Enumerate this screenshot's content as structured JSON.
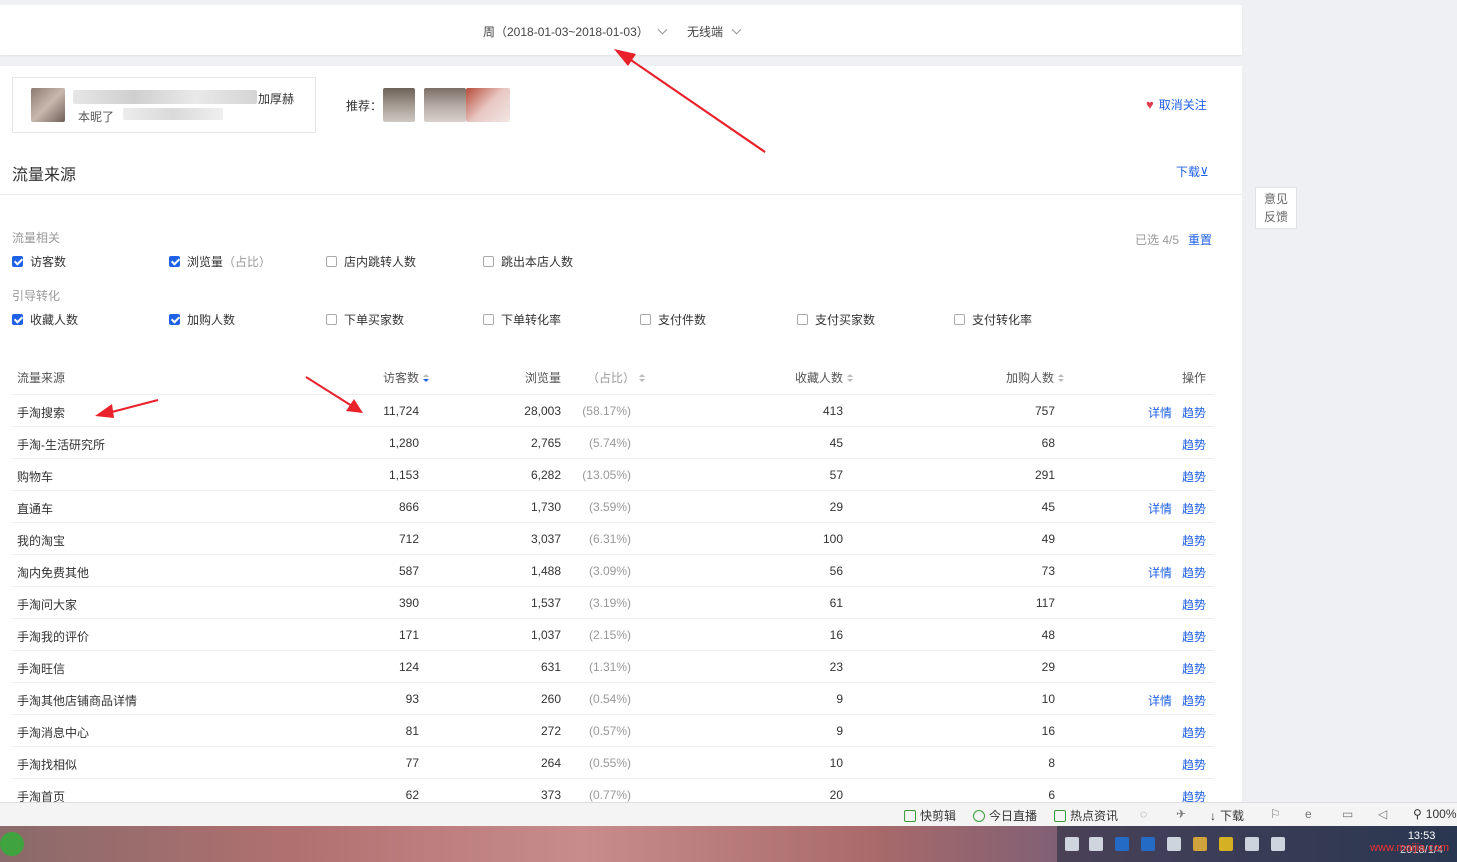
{
  "header": {
    "period": "周（2018-01-03~2018-01-03）",
    "terminal": "无线端"
  },
  "shop": {
    "tag": "加厚赫",
    "sub": "本昵了",
    "recommend_label": "推荐："
  },
  "follow": {
    "label": "取消关注"
  },
  "section": {
    "title": "流量来源",
    "download": "下载⊻"
  },
  "filters": {
    "group1_label": "流量相关",
    "group1": [
      {
        "label": "访客数",
        "checked": true
      },
      {
        "label": "浏览量（占比）",
        "checked": true
      },
      {
        "label": "店内跳转人数",
        "checked": false
      },
      {
        "label": "跳出本店人数",
        "checked": false
      }
    ],
    "group2_label": "引导转化",
    "group2": [
      {
        "label": "收藏人数",
        "checked": true
      },
      {
        "label": "加购人数",
        "checked": true
      },
      {
        "label": "下单买家数",
        "checked": false
      },
      {
        "label": "下单转化率",
        "checked": false
      },
      {
        "label": "支付件数",
        "checked": false
      },
      {
        "label": "支付买家数",
        "checked": false
      },
      {
        "label": "支付转化率",
        "checked": false
      }
    ],
    "selected": "已选 4/5",
    "reset": "重置"
  },
  "table": {
    "headers": {
      "source": "流量来源",
      "visitors": "访客数",
      "pv": "浏览量",
      "share": "（占比）",
      "fav": "收藏人数",
      "cart": "加购人数",
      "ops": "操作"
    },
    "detail_label": "详情",
    "trend_label": "趋势",
    "rows": [
      {
        "source": "手淘搜索",
        "visitors": "11,724",
        "pv": "28,003",
        "share": "(58.17%)",
        "fav": "413",
        "cart": "757",
        "detail": true
      },
      {
        "source": "手淘-生活研究所",
        "visitors": "1,280",
        "pv": "2,765",
        "share": "(5.74%)",
        "fav": "45",
        "cart": "68",
        "detail": false
      },
      {
        "source": "购物车",
        "visitors": "1,153",
        "pv": "6,282",
        "share": "(13.05%)",
        "fav": "57",
        "cart": "291",
        "detail": false
      },
      {
        "source": "直通车",
        "visitors": "866",
        "pv": "1,730",
        "share": "(3.59%)",
        "fav": "29",
        "cart": "45",
        "detail": true
      },
      {
        "source": "我的淘宝",
        "visitors": "712",
        "pv": "3,037",
        "share": "(6.31%)",
        "fav": "100",
        "cart": "49",
        "detail": false
      },
      {
        "source": "淘内免费其他",
        "visitors": "587",
        "pv": "1,488",
        "share": "(3.09%)",
        "fav": "56",
        "cart": "73",
        "detail": true
      },
      {
        "source": "手淘问大家",
        "visitors": "390",
        "pv": "1,537",
        "share": "(3.19%)",
        "fav": "61",
        "cart": "117",
        "detail": false
      },
      {
        "source": "手淘我的评价",
        "visitors": "171",
        "pv": "1,037",
        "share": "(2.15%)",
        "fav": "16",
        "cart": "48",
        "detail": false
      },
      {
        "source": "手淘旺信",
        "visitors": "124",
        "pv": "631",
        "share": "(1.31%)",
        "fav": "23",
        "cart": "29",
        "detail": false
      },
      {
        "source": "手淘其他店铺商品详情",
        "visitors": "93",
        "pv": "260",
        "share": "(0.54%)",
        "fav": "9",
        "cart": "10",
        "detail": true
      },
      {
        "source": "手淘消息中心",
        "visitors": "81",
        "pv": "272",
        "share": "(0.57%)",
        "fav": "9",
        "cart": "16",
        "detail": false
      },
      {
        "source": "手淘找相似",
        "visitors": "77",
        "pv": "264",
        "share": "(0.55%)",
        "fav": "10",
        "cart": "8",
        "detail": false
      },
      {
        "source": "手淘首页",
        "visitors": "62",
        "pv": "373",
        "share": "(0.77%)",
        "fav": "20",
        "cart": "6",
        "detail": false
      }
    ]
  },
  "feedback": {
    "line1": "意见",
    "line2": "反馈"
  },
  "extbar": {
    "items": [
      "快剪辑",
      "今日直播",
      "热点资讯",
      "下载",
      "100%"
    ]
  },
  "taskbar": {
    "time": "13:53",
    "date": "2018/1/4",
    "watermark": "www.maijia.com"
  },
  "colors": {
    "accent": "#2062e6",
    "heart": "#e23b4e",
    "annotation_arrow": "#e8212b"
  }
}
